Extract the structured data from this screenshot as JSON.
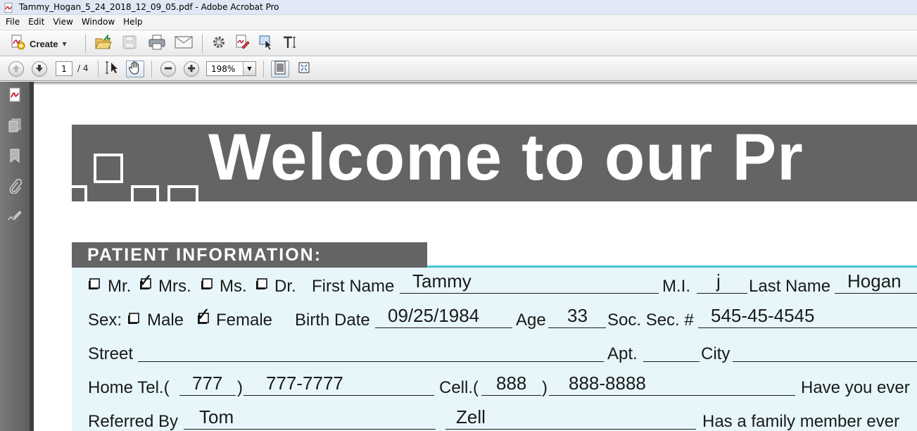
{
  "window": {
    "title": "Tammy_Hogan_5_24_2018_12_09_05.pdf - Adobe Acrobat Pro"
  },
  "menu": [
    "File",
    "Edit",
    "View",
    "Window",
    "Help"
  ],
  "toolbar": {
    "create_label": "Create"
  },
  "nav": {
    "current_page": "1",
    "total_pages": "/ 4",
    "zoom": "198%"
  },
  "form": {
    "banner": "Welcome to our Pr",
    "section_title": "PATIENT INFORMATION:",
    "labels": {
      "mr": "Mr.",
      "mrs": "Mrs.",
      "ms": "Ms.",
      "dr": "Dr.",
      "first_name": "First Name",
      "mi": "M.I.",
      "last_name": "Last Name",
      "sex": "Sex:",
      "male": "Male",
      "female": "Female",
      "birth_date": "Birth Date",
      "age": "Age",
      "ssn": "Soc. Sec. #",
      "street": "Street",
      "apt": "Apt.",
      "city": "City",
      "home_tel": "Home Tel.(",
      "paren_close": ")",
      "cell": "Cell.(",
      "have_you_ever": "Have you ever",
      "referred_by": "Referred By",
      "has_family": "Has a family member ever"
    },
    "values": {
      "first_name": "Tammy",
      "mi": "j",
      "last_name": "Hogan",
      "birth_date": "09/25/1984",
      "age": "33",
      "ssn": "545-45-4545",
      "home_area": "777",
      "home_number": "777-7777",
      "cell_area": "888",
      "cell_number": "888-8888",
      "referred_first": "Tom",
      "referred_last": "Zell"
    },
    "checked": {
      "mrs": true,
      "female": true
    }
  }
}
